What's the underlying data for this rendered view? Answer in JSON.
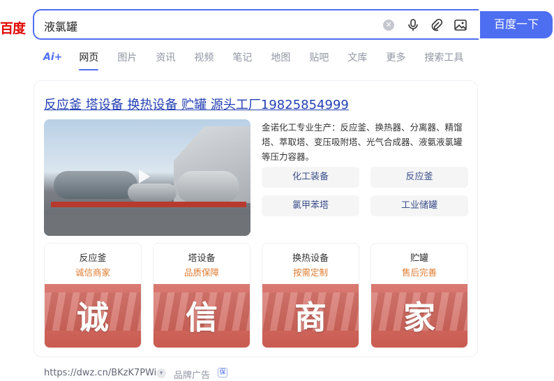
{
  "header": {
    "logo_text": "百度",
    "search_value": "液氯罐",
    "search_button": "百度一下",
    "icons": [
      "clear-icon",
      "microphone-icon",
      "paperclip-icon",
      "image-search-icon"
    ]
  },
  "tabs": {
    "ai_label": "Ai+",
    "items": [
      "网页",
      "图片",
      "资讯",
      "视频",
      "笔记",
      "地图",
      "贴吧",
      "文库",
      "更多",
      "搜索工具"
    ],
    "active_index": 0
  },
  "ad": {
    "title": "反应釜 塔设备 换热设备 贮罐 源头工厂19825854999",
    "description": "金诺化工专业生产：反应釜、换热器、分离器、精馏塔、萃取塔、变压吸附塔、光气合成器、液氨液氯罐等压力容器。",
    "chips": [
      "化工装备",
      "反应釜",
      "氯甲苯塔",
      "工业储罐"
    ],
    "tiles": [
      {
        "label": "反应釜",
        "sub": "诚信商家",
        "big": "诚"
      },
      {
        "label": "塔设备",
        "sub": "品质保障",
        "big": "信"
      },
      {
        "label": "换热设备",
        "sub": "按需定制",
        "big": "商"
      },
      {
        "label": "贮罐",
        "sub": "售后完善",
        "big": "家"
      }
    ],
    "url": "https://dwz.cn/BKzK7PWi",
    "brand_ad": "品牌广告",
    "badge": "保"
  },
  "colors": {
    "accent": "#4e6ef2",
    "link": "#2440b3",
    "logo": "#e10602",
    "tile_sub": "#e07a2e"
  }
}
